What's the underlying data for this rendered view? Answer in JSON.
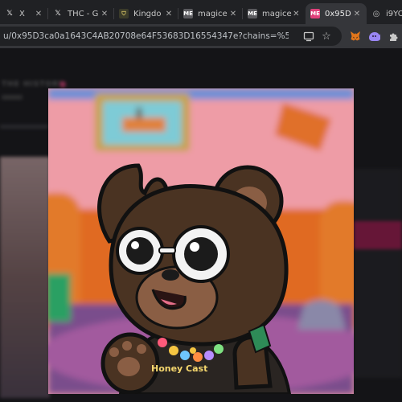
{
  "tabs": [
    {
      "label": "X",
      "favicon": "x-logo-icon",
      "active": false
    },
    {
      "label": "THC - G",
      "favicon": "x-logo-icon",
      "active": false
    },
    {
      "label": "Kingdo",
      "favicon": "shield-icon",
      "active": false
    },
    {
      "label": "magice",
      "favicon": "magiceden-icon",
      "active": false
    },
    {
      "label": "magice",
      "favicon": "magiceden-icon",
      "active": false
    },
    {
      "label": "0x95D",
      "favicon": "magiceden-icon",
      "active": true
    },
    {
      "label": "i9YO",
      "favicon": "globe-icon",
      "active": false
    }
  ],
  "address_bar": {
    "url": "u/0x95D3ca0a1643C4AB20708e64F53683D16554347e?chains=%5B\"berachain\"%5D..."
  },
  "page_background": {
    "header_text": "THE HISTORY"
  },
  "nft": {
    "shirt_text": "Honey Cast",
    "colors": {
      "wall": "#ec9aa4",
      "couch": "#e2701f",
      "bear": "#4a3322",
      "muzzle": "#8a5e44",
      "floor": "#7a4d8c"
    }
  },
  "colors": {
    "accent": "#e0407a",
    "tabstrip": "#202124",
    "toolbar": "#35363a"
  }
}
